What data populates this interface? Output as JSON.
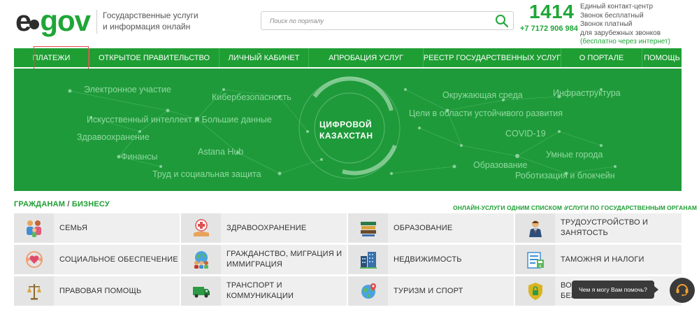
{
  "header": {
    "logo": {
      "e": "e",
      "gov": "gov"
    },
    "tagline": "Государственные услуги и информация онлайн",
    "search": {
      "placeholder": "Поиск по порталу"
    },
    "contact": {
      "number": "1414",
      "phone": "+7 7172 906 984",
      "line1": "Единый контакт-центр",
      "line2": "Звонок бесплатный",
      "line3": "Звонок платный",
      "line4": "для зарубежных звонков",
      "line5": "(бесплатно через интернет)"
    }
  },
  "nav": {
    "items": [
      {
        "label": "ПЛАТЕЖИ"
      },
      {
        "label": "ОТКРЫТОЕ ПРАВИТЕЛЬСТВО"
      },
      {
        "label": "ЛИЧНЫЙ КАБИНЕТ"
      },
      {
        "label": "АПРОБАЦИЯ УСЛУГ"
      },
      {
        "label": "РЕЕСТР ГОСУДАРСТВЕННЫХ УСЛУГ"
      },
      {
        "label": "О ПОРТАЛЕ"
      },
      {
        "label": "ПОМОЩЬ"
      }
    ]
  },
  "banner": {
    "title_line1": "ЦИФРОВОЙ",
    "title_line2": "КАЗАХСТАН",
    "labels": [
      "Электронное участие",
      "Кибербезопасность",
      "Искусственный интеллект и Большие данные",
      "Здравоохранение",
      "Финансы",
      "Astana Hub",
      "Труд и социальная защита",
      "Окружающая среда",
      "Инфраструктура",
      "Цели в области устойчивого развития",
      "COVID-19",
      "Умные города",
      "Образование",
      "Роботизация и блокчейн"
    ]
  },
  "section": {
    "title_left": "ГРАЖДАНАМ",
    "title_sep": " / ",
    "title_right": "БИЗНЕСУ",
    "link1": "ОНЛАЙН-УСЛУГИ ОДНИМ СПИСКОМ ›",
    "link2": "УСЛУГИ ПО ГОСУДАРСТВЕННЫМ ОРГАНАМ ›"
  },
  "categories": [
    {
      "label": "СЕМЬЯ",
      "icon": "family-icon"
    },
    {
      "label": "ЗДРАВООХРАНЕНИЕ",
      "icon": "healthcare-icon"
    },
    {
      "label": "ОБРАЗОВАНИЕ",
      "icon": "books-icon"
    },
    {
      "label": "ТРУДОУСТРОЙСТВО И ЗАНЯТОСТЬ",
      "icon": "worker-icon"
    },
    {
      "label": "СОЦИАЛЬНОЕ ОБЕСПЕЧЕНИЕ",
      "icon": "social-heart-icon"
    },
    {
      "label": "ГРАЖДАНСТВО, МИГРАЦИЯ И ИММИГРАЦИЯ",
      "icon": "globe-people-icon"
    },
    {
      "label": "НЕДВИЖИМОСТЬ",
      "icon": "buildings-icon"
    },
    {
      "label": "ТАМОЖНЯ И НАЛОГИ",
      "icon": "customs-icon"
    },
    {
      "label": "ПРАВОВАЯ ПОМОЩЬ",
      "icon": "scales-icon"
    },
    {
      "label": "ТРАНСПОРТ И КОММУНИКАЦИИ",
      "icon": "truck-icon"
    },
    {
      "label": "ТУРИЗМ И СПОРТ",
      "icon": "globe-pin-icon"
    },
    {
      "label": "ВОИНСКАЯ СЛУЖБА И БЕЗОПАСНОСТЬ",
      "icon": "shield-lock-icon"
    }
  ],
  "chat": {
    "tooltip": "Чем я могу Вам помочь?"
  },
  "colors": {
    "brand": "#1fa637",
    "nav": "#1e9e33",
    "banner": "#1f9a3a",
    "highlight": "#e34a4a"
  }
}
